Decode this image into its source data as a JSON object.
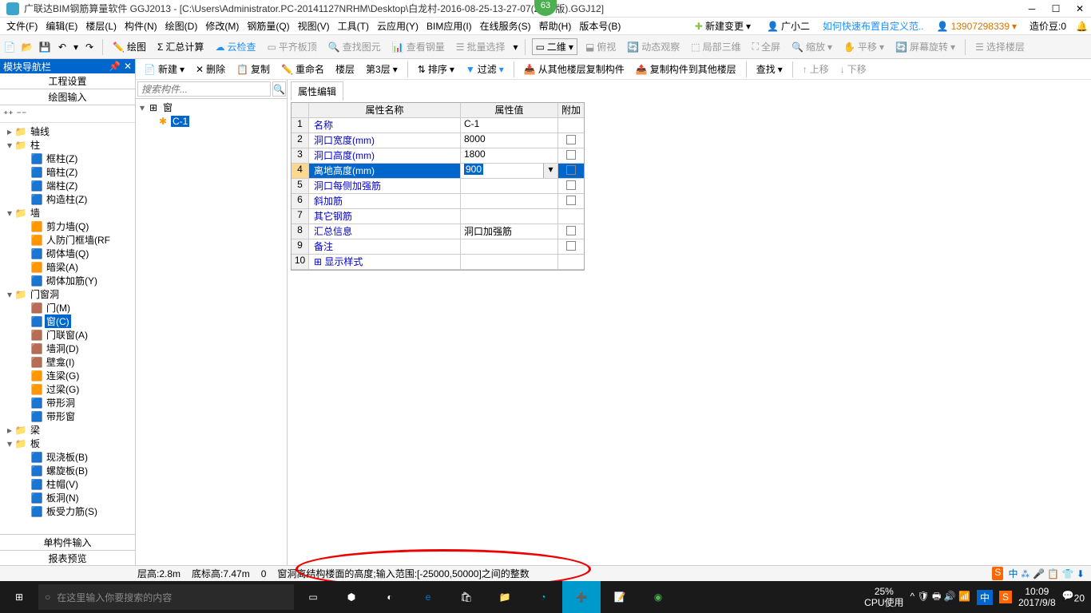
{
  "title": "广联达BIM钢筋算量软件 GGJ2013 - [C:\\Users\\Administrator.PC-20141127NRHM\\Desktop\\白龙村-2016-08-25-13-27-07(2166版).GGJ12]",
  "badge": "63",
  "menu": [
    "文件(F)",
    "编辑(E)",
    "楼层(L)",
    "构件(N)",
    "绘图(D)",
    "修改(M)",
    "钢筋量(Q)",
    "视图(V)",
    "工具(T)",
    "云应用(Y)",
    "BIM应用(I)",
    "在线服务(S)",
    "帮助(H)",
    "版本号(B)"
  ],
  "menu_right": {
    "new_change": "新建变更",
    "user": "广小二",
    "tip": "如何快速布置自定义范..",
    "phone": "13907298339",
    "coin": "造价豆:0"
  },
  "toolbar1": {
    "draw": "绘图",
    "sum": "汇总计算",
    "cloud": "云检查",
    "flat": "平齐板顶",
    "find": "查找图元",
    "steel": "查看钢量",
    "batch": "批量选择",
    "view2d": "二维",
    "top": "俯视",
    "dyn": "动态观察",
    "local3d": "局部三维",
    "full": "全屏",
    "zoom": "缩放",
    "pan": "平移",
    "rotate": "屏幕旋转",
    "sel": "选择楼层"
  },
  "mid_toolbar": {
    "new": "新建",
    "del": "删除",
    "copy": "复制",
    "rename": "重命名",
    "floor": "楼层",
    "floor3": "第3层",
    "sort": "排序",
    "filter": "过滤",
    "copyfrom": "从其他楼层复制构件",
    "copyto": "复制构件到其他楼层",
    "find": "查找",
    "up": "上移",
    "down": "下移"
  },
  "nav": {
    "title": "模块导航栏",
    "tab1": "工程设置",
    "tab2": "绘图输入",
    "bottom1": "单构件输入",
    "bottom2": "报表预览"
  },
  "tree": [
    {
      "l": 0,
      "t": "▸",
      "i": "📁",
      "n": "轴线"
    },
    {
      "l": 0,
      "t": "▾",
      "i": "📁",
      "n": "柱"
    },
    {
      "l": 1,
      "t": "",
      "i": "🟦",
      "n": "框柱(Z)"
    },
    {
      "l": 1,
      "t": "",
      "i": "🟦",
      "n": "暗柱(Z)"
    },
    {
      "l": 1,
      "t": "",
      "i": "🟦",
      "n": "端柱(Z)"
    },
    {
      "l": 1,
      "t": "",
      "i": "🟦",
      "n": "构造柱(Z)"
    },
    {
      "l": 0,
      "t": "▾",
      "i": "📁",
      "n": "墙"
    },
    {
      "l": 1,
      "t": "",
      "i": "🟧",
      "n": "剪力墙(Q)"
    },
    {
      "l": 1,
      "t": "",
      "i": "🟧",
      "n": "人防门框墙(RF"
    },
    {
      "l": 1,
      "t": "",
      "i": "🟦",
      "n": "砌体墙(Q)"
    },
    {
      "l": 1,
      "t": "",
      "i": "🟧",
      "n": "暗梁(A)"
    },
    {
      "l": 1,
      "t": "",
      "i": "🟦",
      "n": "砌体加筋(Y)"
    },
    {
      "l": 0,
      "t": "▾",
      "i": "📁",
      "n": "门窗洞"
    },
    {
      "l": 1,
      "t": "",
      "i": "🟫",
      "n": "门(M)"
    },
    {
      "l": 1,
      "t": "",
      "i": "🟦",
      "n": "窗(C)",
      "sel": true
    },
    {
      "l": 1,
      "t": "",
      "i": "🟫",
      "n": "门联窗(A)"
    },
    {
      "l": 1,
      "t": "",
      "i": "🟫",
      "n": "墙洞(D)"
    },
    {
      "l": 1,
      "t": "",
      "i": "🟫",
      "n": "壁龛(I)"
    },
    {
      "l": 1,
      "t": "",
      "i": "🟧",
      "n": "连梁(G)"
    },
    {
      "l": 1,
      "t": "",
      "i": "🟧",
      "n": "过梁(G)"
    },
    {
      "l": 1,
      "t": "",
      "i": "🟦",
      "n": "带形洞"
    },
    {
      "l": 1,
      "t": "",
      "i": "🟦",
      "n": "带形窗"
    },
    {
      "l": 0,
      "t": "▸",
      "i": "📁",
      "n": "梁"
    },
    {
      "l": 0,
      "t": "▾",
      "i": "📁",
      "n": "板"
    },
    {
      "l": 1,
      "t": "",
      "i": "🟦",
      "n": "现浇板(B)"
    },
    {
      "l": 1,
      "t": "",
      "i": "🟦",
      "n": "螺旋板(B)"
    },
    {
      "l": 1,
      "t": "",
      "i": "🟦",
      "n": "柱帽(V)"
    },
    {
      "l": 1,
      "t": "",
      "i": "🟦",
      "n": "板洞(N)"
    },
    {
      "l": 1,
      "t": "",
      "i": "🟦",
      "n": "板受力筋(S)"
    }
  ],
  "search_placeholder": "搜索构件...",
  "mid_tree": {
    "root": "窗",
    "child": "C-1"
  },
  "prop": {
    "tab": "属性编辑",
    "hdr": {
      "name": "属性名称",
      "val": "属性值",
      "add": "附加"
    },
    "rows": [
      {
        "n": "1",
        "name": "名称",
        "val": "C-1",
        "chk": false
      },
      {
        "n": "2",
        "name": "洞口宽度(mm)",
        "val": "8000",
        "chk": true
      },
      {
        "n": "3",
        "name": "洞口高度(mm)",
        "val": "1800",
        "chk": true
      },
      {
        "n": "4",
        "name": "离地高度(mm)",
        "val": "900",
        "chk": true,
        "sel": true
      },
      {
        "n": "5",
        "name": "洞口每侧加强筋",
        "val": "",
        "chk": true
      },
      {
        "n": "6",
        "name": "斜加筋",
        "val": "",
        "chk": true
      },
      {
        "n": "7",
        "name": "其它钢筋",
        "val": "",
        "chk": false
      },
      {
        "n": "8",
        "name": "汇总信息",
        "val": "洞口加强筋",
        "chk": true
      },
      {
        "n": "9",
        "name": "备注",
        "val": "",
        "chk": true
      },
      {
        "n": "10",
        "name": "显示样式",
        "val": "",
        "chk": false,
        "exp": true
      }
    ]
  },
  "status": {
    "h": "层高:2.8m",
    "b": "底标高:7.47m",
    "z": "0",
    "hint": "窗洞离结构楼面的高度;输入范围:[-25000,50000]之间的整数"
  },
  "taskbar": {
    "search": "在这里输入你要搜索的内容",
    "cpu1": "25%",
    "cpu2": "CPU使用",
    "ime": "中",
    "time": "10:09",
    "date": "2017/9/8",
    "num": "20"
  }
}
